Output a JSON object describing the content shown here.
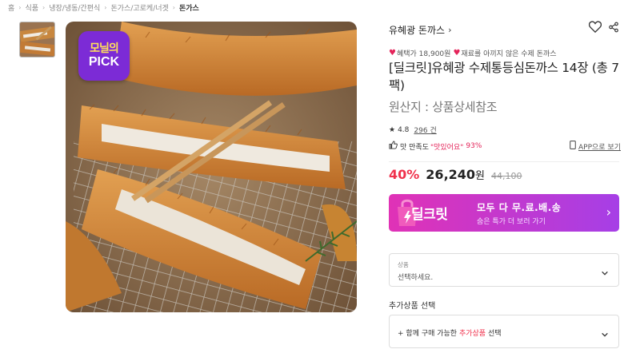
{
  "breadcrumb": [
    "홈",
    "식품",
    "냉장/냉동/간편식",
    "돈가스/고로케/너겟",
    "돈가스"
  ],
  "badge": {
    "line1": "모닐의",
    "line2": "PICK"
  },
  "product": {
    "brand": "유혜광 돈까스",
    "brand_arrow": "›",
    "promo_prefix": "혜택가 18,900원",
    "promo_suffix": "재료를 아끼지 않은 수제 돈까스",
    "title": "[딜크릿]유혜광 수제통등심돈까스 14장 (총 7팩)",
    "origin": "원산지 : 상품상세참조",
    "rating": "4.8",
    "review_count": "296 건",
    "taste_prefix": "맛 만족도",
    "taste_highlight": "\"맛있어요\"",
    "taste_percent": "93%",
    "app_view": "APP으로 보기",
    "discount": "40%",
    "price": "26,240",
    "won": "원",
    "original_price": "44,100"
  },
  "deal_banner": {
    "logo": "딜크릿",
    "main": "모두 다 무.료.배.송",
    "sub": "숨은 특가 더 보러 가기",
    "arrow": "›"
  },
  "option_select": {
    "label": "상품",
    "placeholder": "선택하세요."
  },
  "add_product": {
    "section_label": "추가상품 선택",
    "prefix": "+ 함께 구매 가능한",
    "highlight": "추가상품",
    "suffix": "선택"
  },
  "colors": {
    "accent": "#f0314c",
    "heart": "#e4245a",
    "banner_start": "#e032b6",
    "banner_end": "#a63fe6",
    "badge": "#7c2bd6"
  },
  "icons": [
    "heart-outline-icon",
    "share-icon",
    "star-icon",
    "thumbs-up-icon",
    "phone-icon",
    "chevron-down-icon",
    "chevron-right-icon"
  ]
}
